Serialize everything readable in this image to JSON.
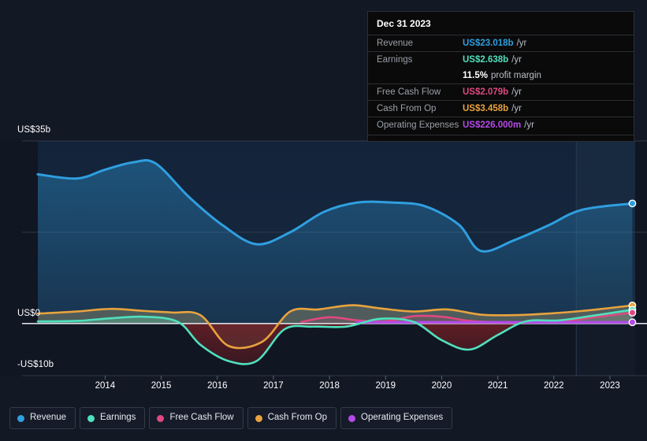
{
  "tooltip": {
    "date": "Dec 31 2023",
    "rows": [
      {
        "name": "Revenue",
        "value": "US$23.018b",
        "unit": "/yr",
        "color": "#2f9fe0"
      },
      {
        "name": "Earnings",
        "value": "US$2.638b",
        "unit": "/yr",
        "color": "#4fe0bd"
      },
      {
        "name": "",
        "value": "11.5%",
        "unit": "profit margin",
        "color": "#ffffff"
      },
      {
        "name": "Free Cash Flow",
        "value": "US$2.079b",
        "unit": "/yr",
        "color": "#e0487f"
      },
      {
        "name": "Cash From Op",
        "value": "US$3.458b",
        "unit": "/yr",
        "color": "#e8a33d"
      },
      {
        "name": "Operating Expenses",
        "value": "US$226.000m",
        "unit": "/yr",
        "color": "#b44ae8"
      }
    ]
  },
  "legend": {
    "items": [
      {
        "label": "Revenue",
        "color": "#2f9fe0"
      },
      {
        "label": "Earnings",
        "color": "#4fe0bd"
      },
      {
        "label": "Free Cash Flow",
        "color": "#e0487f"
      },
      {
        "label": "Cash From Op",
        "color": "#e8a33d"
      },
      {
        "label": "Operating Expenses",
        "color": "#b44ae8"
      }
    ]
  },
  "axis": {
    "y_top": "US$35b",
    "y_zero": "US$0",
    "y_bottom": "-US$10b",
    "x_ticks": [
      "2014",
      "2015",
      "2016",
      "2017",
      "2018",
      "2019",
      "2020",
      "2021",
      "2022",
      "2023"
    ]
  },
  "chart_data": {
    "type": "area",
    "title": "",
    "xlabel": "",
    "ylabel": "",
    "ylim": [
      -10,
      35
    ],
    "yticks": [
      35,
      0,
      -10
    ],
    "ytick_labels": [
      "US$35b",
      "US$0",
      "-US$10b"
    ],
    "xlim": [
      2013.3,
      2023.95
    ],
    "x": [
      "2014",
      "2015",
      "2016",
      "2017",
      "2018",
      "2019",
      "2020",
      "2021",
      "2022",
      "2023"
    ],
    "grid": true,
    "legend_position": "bottom",
    "units": "US$ billions per year",
    "forecast_divider_x": 2022.9,
    "series": [
      {
        "name": "Revenue",
        "color": "#2f9fe0",
        "x": [
          2013.3,
          2014.0,
          2014.5,
          2015.0,
          2015.4,
          2016.0,
          2016.6,
          2017.2,
          2017.8,
          2018.4,
          2019.0,
          2019.6,
          2020.2,
          2020.8,
          2021.2,
          2021.8,
          2022.4,
          2023.0,
          2023.9
        ],
        "values": [
          28.6,
          27.8,
          29.5,
          30.9,
          30.7,
          24.2,
          18.8,
          15.2,
          17.5,
          21.4,
          23.2,
          23.2,
          22.5,
          19.0,
          13.9,
          16.0,
          18.8,
          21.8,
          23.018
        ]
      },
      {
        "name": "Earnings",
        "color": "#4fe0bd",
        "x": [
          2013.3,
          2014.0,
          2014.6,
          2015.2,
          2015.8,
          2016.2,
          2016.7,
          2017.2,
          2017.7,
          2018.2,
          2018.8,
          2019.4,
          2020.0,
          2020.5,
          2021.0,
          2021.5,
          2022.0,
          2022.6,
          2023.2,
          2023.9
        ],
        "values": [
          0.4,
          0.5,
          1.0,
          1.3,
          0.3,
          -4.1,
          -7.2,
          -7.2,
          -1.1,
          -0.6,
          -0.6,
          0.9,
          0.3,
          -3.2,
          -5.0,
          -2.2,
          0.4,
          0.6,
          1.5,
          2.638
        ]
      },
      {
        "name": "Free Cash Flow",
        "color": "#e0487f",
        "x": [
          2018.0,
          2018.5,
          2019.0,
          2019.5,
          2020.0,
          2020.5,
          2021.0,
          2021.6,
          2022.2,
          2022.8,
          2023.3,
          2023.9
        ],
        "values": [
          0.3,
          1.2,
          0.6,
          0.4,
          1.4,
          1.3,
          0.5,
          0.2,
          0.2,
          0.6,
          1.3,
          2.079
        ]
      },
      {
        "name": "Cash From Op",
        "color": "#e8a33d",
        "x": [
          2013.3,
          2014.0,
          2014.6,
          2015.2,
          2015.7,
          2016.2,
          2016.7,
          2017.3,
          2017.8,
          2018.3,
          2018.9,
          2019.4,
          2020.0,
          2020.6,
          2021.2,
          2021.8,
          2022.4,
          2023.0,
          2023.9
        ],
        "values": [
          1.9,
          2.3,
          2.8,
          2.4,
          2.1,
          1.6,
          -4.3,
          -3.5,
          2.3,
          2.7,
          3.5,
          2.9,
          2.3,
          2.7,
          1.7,
          1.6,
          1.9,
          2.4,
          3.458
        ]
      },
      {
        "name": "Operating Expenses",
        "color": "#b44ae8",
        "x": [
          2019.0,
          2020.0,
          2021.0,
          2022.0,
          2023.0,
          2023.9
        ],
        "values": [
          0.23,
          0.23,
          0.23,
          0.23,
          0.23,
          0.226
        ]
      }
    ]
  }
}
